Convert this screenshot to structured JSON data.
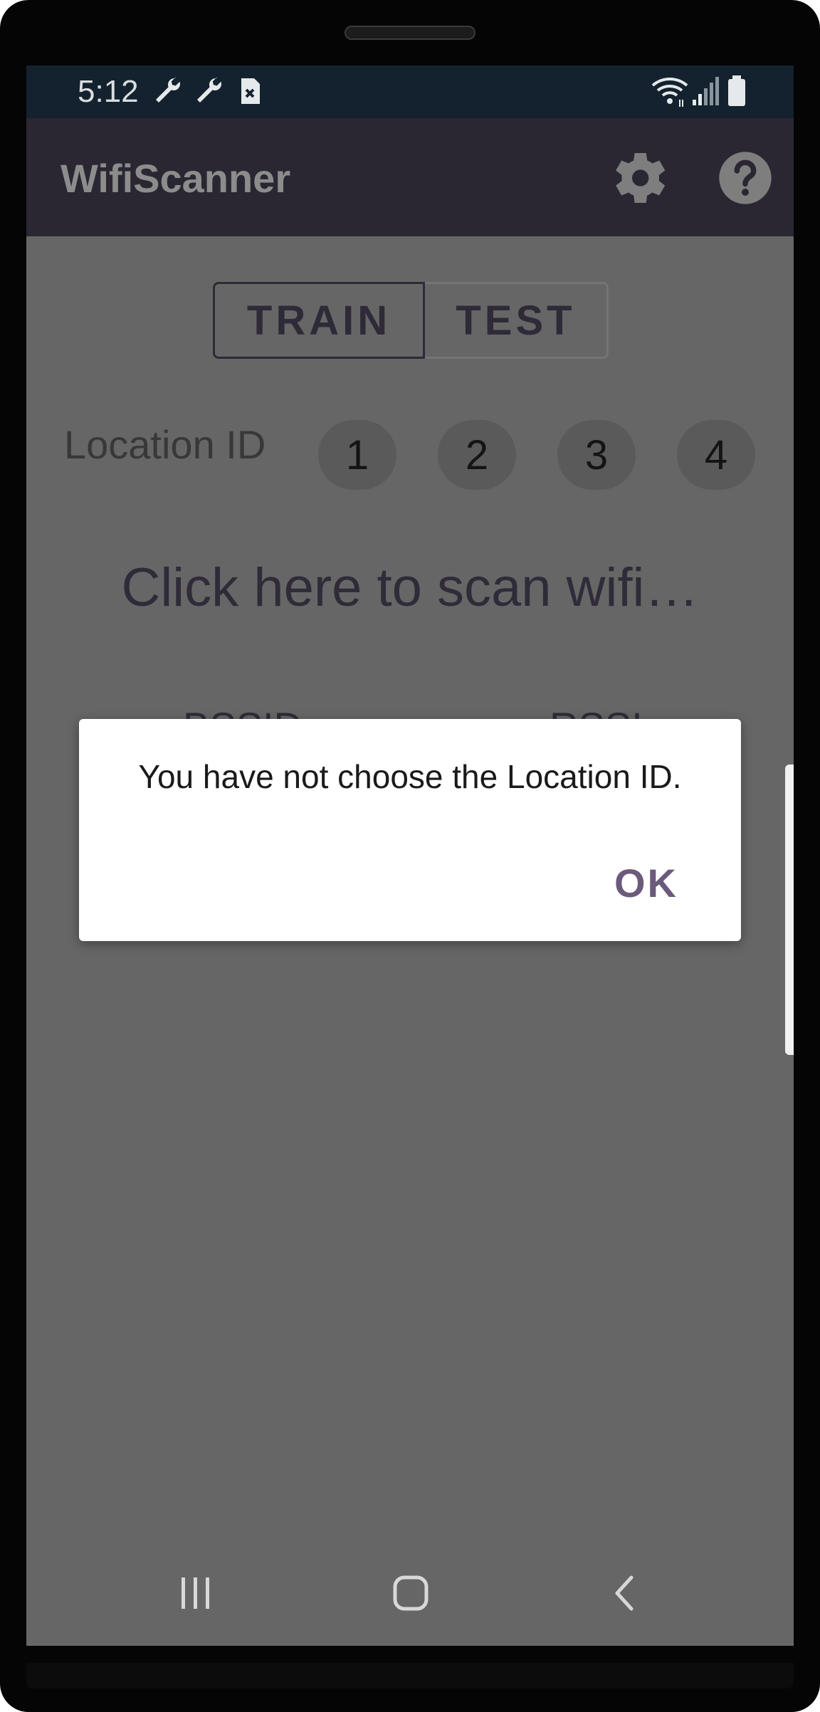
{
  "status_bar": {
    "time": "5:12",
    "left_icons": [
      "wrench-icon",
      "wrench-icon",
      "sim-error-icon"
    ],
    "right_icons": [
      "wifi-icon",
      "signal-icon",
      "battery-icon"
    ]
  },
  "app_bar": {
    "title": "WifiScanner",
    "actions": [
      "settings-icon",
      "help-icon"
    ]
  },
  "mode_toggle": {
    "options": [
      "TRAIN",
      "TEST"
    ],
    "selected": "TRAIN"
  },
  "location": {
    "label": "Location ID",
    "options": [
      "1",
      "2",
      "3",
      "4"
    ]
  },
  "scan_prompt": "Click here to scan wifi…",
  "columns": [
    "BSSID",
    "RSSI"
  ],
  "dialog": {
    "message": "You have not choose the Location ID.",
    "ok_label": "OK"
  },
  "nav_bar": [
    "recent-apps-icon",
    "home-icon",
    "back-icon"
  ],
  "colors": {
    "status_bar": "#13222e",
    "app_bar": "#2a2733",
    "scrim": "#666666",
    "accent": "#6c5a7c"
  }
}
